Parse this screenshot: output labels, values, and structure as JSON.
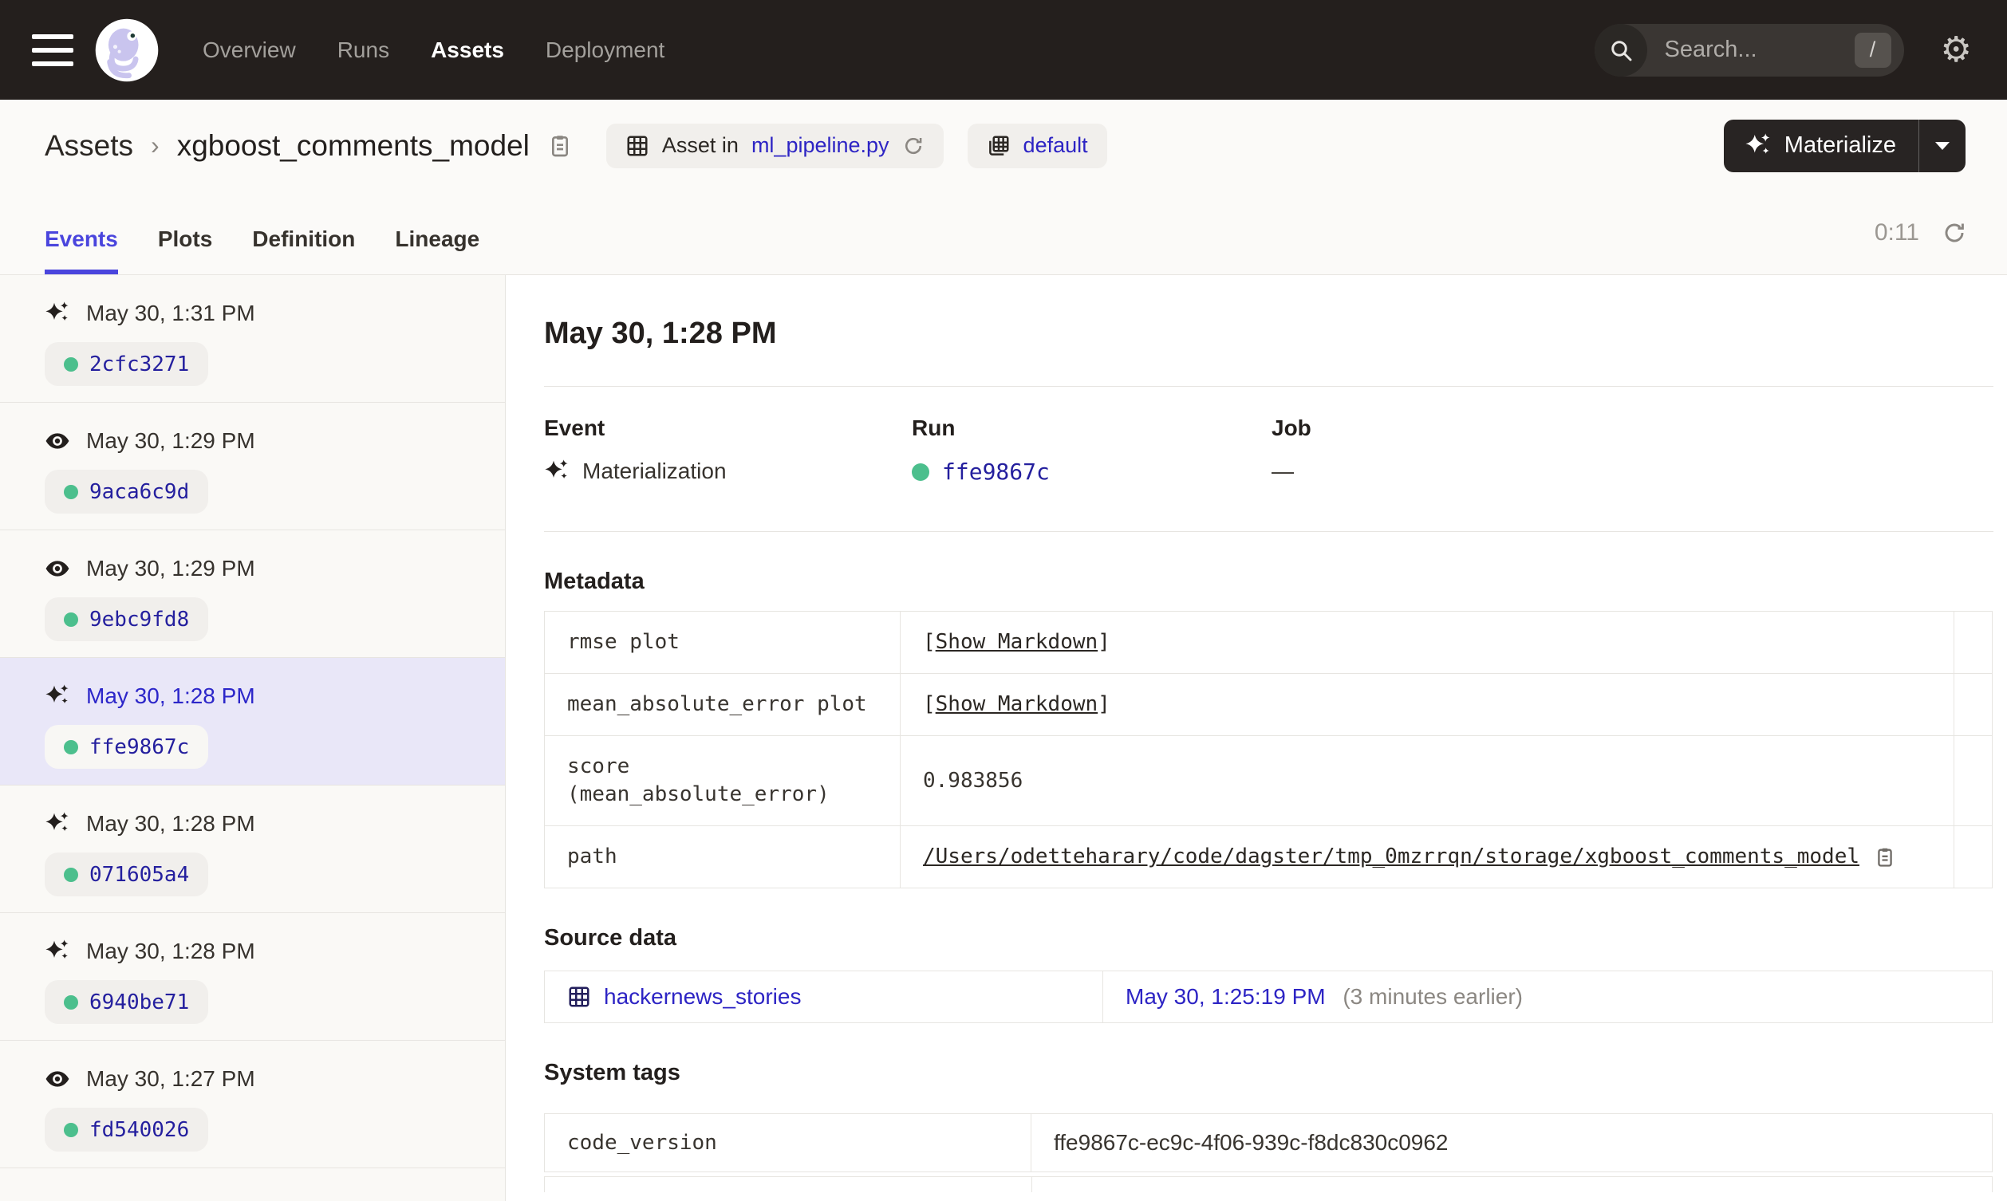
{
  "nav": {
    "items": [
      {
        "label": "Overview"
      },
      {
        "label": "Runs"
      },
      {
        "label": "Assets"
      },
      {
        "label": "Deployment"
      }
    ],
    "active": "Assets",
    "search": {
      "placeholder": "Search...",
      "shortcut": "/"
    }
  },
  "header": {
    "breadcrumb_root": "Assets",
    "breadcrumb_sep": "›",
    "asset_name": "xgboost_comments_model",
    "asset_pill_prefix": "Asset in",
    "asset_pill_link": "ml_pipeline.py",
    "group_pill_label": "default",
    "materialize_label": "Materialize"
  },
  "tabs": {
    "items": [
      {
        "label": "Events"
      },
      {
        "label": "Plots"
      },
      {
        "label": "Definition"
      },
      {
        "label": "Lineage"
      }
    ],
    "active": "Events",
    "refresh_timer": "0:11"
  },
  "sidebar": {
    "events": [
      {
        "type": "materialization",
        "time": "May 30, 1:31 PM",
        "run_id": "2cfc3271",
        "selected": false
      },
      {
        "type": "observation",
        "time": "May 30, 1:29 PM",
        "run_id": "9aca6c9d",
        "selected": false
      },
      {
        "type": "observation",
        "time": "May 30, 1:29 PM",
        "run_id": "9ebc9fd8",
        "selected": false
      },
      {
        "type": "materialization",
        "time": "May 30, 1:28 PM",
        "run_id": "ffe9867c",
        "selected": true
      },
      {
        "type": "materialization",
        "time": "May 30, 1:28 PM",
        "run_id": "071605a4",
        "selected": false
      },
      {
        "type": "materialization",
        "time": "May 30, 1:28 PM",
        "run_id": "6940be71",
        "selected": false
      },
      {
        "type": "observation",
        "time": "May 30, 1:27 PM",
        "run_id": "fd540026",
        "selected": false
      }
    ]
  },
  "detail": {
    "title": "May 30, 1:28 PM",
    "columns": {
      "event_label": "Event",
      "event_value": "Materialization",
      "run_label": "Run",
      "run_value": "ffe9867c",
      "job_label": "Job",
      "job_value": "—"
    },
    "metadata": {
      "heading": "Metadata",
      "rows": [
        {
          "key": "rmse plot",
          "lb": "[",
          "link_label": "Show Markdown",
          "rb": "]"
        },
        {
          "key": "mean_absolute_error plot",
          "lb": "[",
          "link_label": "Show Markdown",
          "rb": "]"
        },
        {
          "key": "score (mean_absolute_error)",
          "value": "0.983856"
        },
        {
          "key": "path",
          "value": "/Users/odetteharary/code/dagster/tmp_0mzrrqn/storage/xgboost_comments_model"
        }
      ]
    },
    "source_data": {
      "heading": "Source data",
      "asset_link": "hackernews_stories",
      "timestamp_link": "May 30, 1:25:19 PM",
      "note": "(3 minutes earlier)"
    },
    "system_tags": {
      "heading": "System tags",
      "rows": [
        {
          "key": "code_version",
          "value": "ffe9867c-ec9c-4f06-939c-f8dc830c0962"
        }
      ]
    }
  },
  "colors": {
    "nav_bg": "#241f1d",
    "accent_tab": "#4a45dd",
    "link_blue": "#2d24c4",
    "run_link_navy": "#241f9e",
    "success_green": "#4cbf8d",
    "selected_row_bg": "#e9e7f8"
  }
}
